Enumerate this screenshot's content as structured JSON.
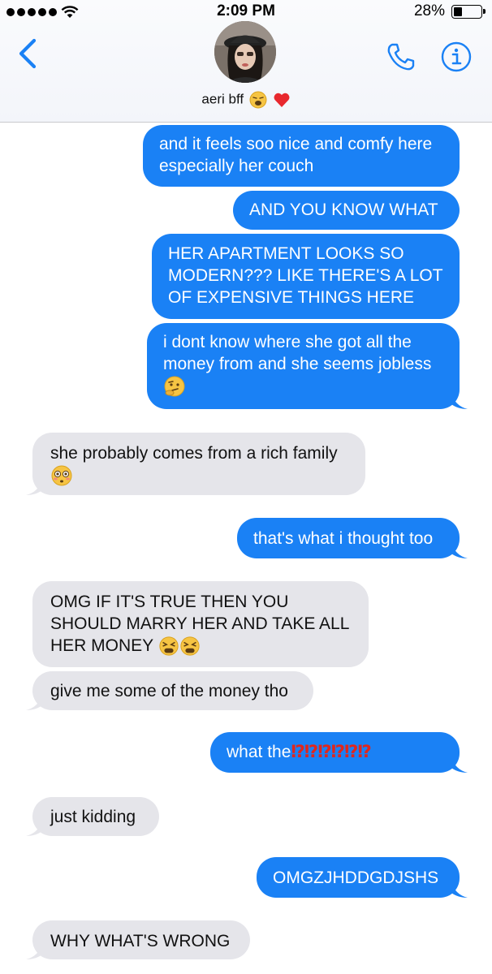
{
  "status_bar": {
    "time": "2:09 PM",
    "battery_percent": "28%",
    "battery_level": 0.28,
    "signal_bars": 5
  },
  "header": {
    "contact_name": "aeri bff",
    "contact_emojis": [
      "weary-face",
      "red-heart"
    ],
    "icons": [
      "chevron-left-icon",
      "phone-icon",
      "info-icon"
    ]
  },
  "colors": {
    "sent_bubble": "#1a81f5",
    "received_bubble": "#e5e5ea",
    "accent": "#1a81f5"
  },
  "messages": [
    {
      "dir": "sent",
      "text": "and it feels soo nice and comfy here especially her couch"
    },
    {
      "dir": "sent",
      "text": "AND YOU KNOW WHAT"
    },
    {
      "dir": "sent",
      "text": "HER APARTMENT LOOKS SO MODERN??? LIKE THERE'S A LOT OF EXPENSIVE THINGS HERE"
    },
    {
      "dir": "sent",
      "text": "i dont know where she got all the money from and she seems jobless",
      "emoji": "thinking-face"
    },
    {
      "dir": "received",
      "text": "she probably comes from a rich family",
      "emoji": "flushed-face"
    },
    {
      "dir": "sent",
      "text": "that's what i thought too"
    },
    {
      "dir": "received",
      "text": "OMG IF IT'S TRUE THEN YOU SHOULD MARRY HER AND TAKE ALL HER MONEY",
      "emoji": "tired-face x2"
    },
    {
      "dir": "received",
      "text": "give me some of the money tho"
    },
    {
      "dir": "sent",
      "text": "what the",
      "suffix": "⁉⁉⁉⁉⁉⁉"
    },
    {
      "dir": "received",
      "text": "just kidding"
    },
    {
      "dir": "sent",
      "text": "OMGZJHDDGDJSHS"
    },
    {
      "dir": "received",
      "text": "WHY WHAT'S WRONG"
    }
  ]
}
